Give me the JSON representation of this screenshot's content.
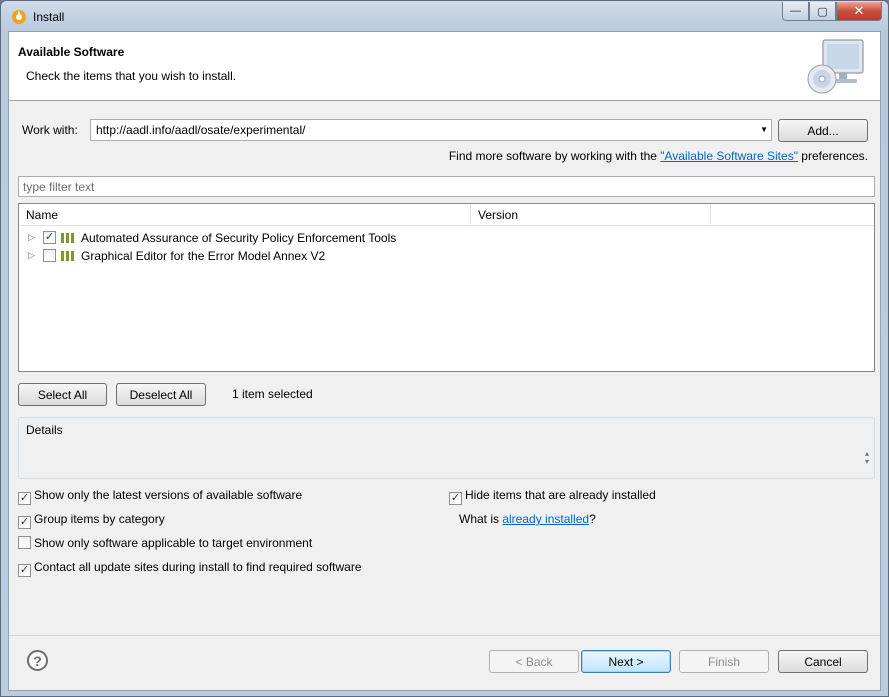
{
  "window": {
    "title": "Install",
    "minimize_glyph": "—",
    "maximize_glyph": "▢",
    "close_glyph": "✕"
  },
  "header": {
    "title": "Available Software",
    "description": "Check the items that you wish to install."
  },
  "work_with": {
    "label": "Work with:",
    "value": "http://aadl.info/aadl/osate/experimental/",
    "add_button": "Add...",
    "more_prefix": "Find more software by working with the ",
    "more_link": "\"Available Software Sites\"",
    "more_suffix": " preferences."
  },
  "filter": {
    "placeholder": "type filter text"
  },
  "tree": {
    "columns": [
      "Name",
      "Version"
    ],
    "rows": [
      {
        "name": "Automated Assurance of Security Policy Enforcement Tools",
        "version": "",
        "checked": true
      },
      {
        "name": "Graphical Editor for the Error Model Annex V2",
        "version": "",
        "checked": false
      }
    ]
  },
  "selection": {
    "select_all": "Select All",
    "deselect_all": "Deselect All",
    "status": "1 item selected"
  },
  "details": {
    "title": "Details"
  },
  "options": {
    "latest_versions": {
      "label": "Show only the latest versions of available software",
      "checked": true
    },
    "group_by_category": {
      "label": "Group items by category",
      "checked": true
    },
    "target_env": {
      "label": "Show only software applicable to target environment",
      "checked": false
    },
    "contact_sites": {
      "label": "Contact all update sites during install to find required software",
      "checked": true
    },
    "hide_installed": {
      "label": "Hide items that are already installed",
      "checked": true
    },
    "what_is_prefix": "What is ",
    "what_is_link": "already installed",
    "what_is_suffix": "?"
  },
  "footer": {
    "help_glyph": "?",
    "back": "< Back",
    "next": "Next >",
    "finish": "Finish",
    "cancel": "Cancel"
  },
  "colors": {
    "link": "#0066cc",
    "accent_button": "#3c7fb1",
    "feature_icon": "#7a9a2a"
  }
}
